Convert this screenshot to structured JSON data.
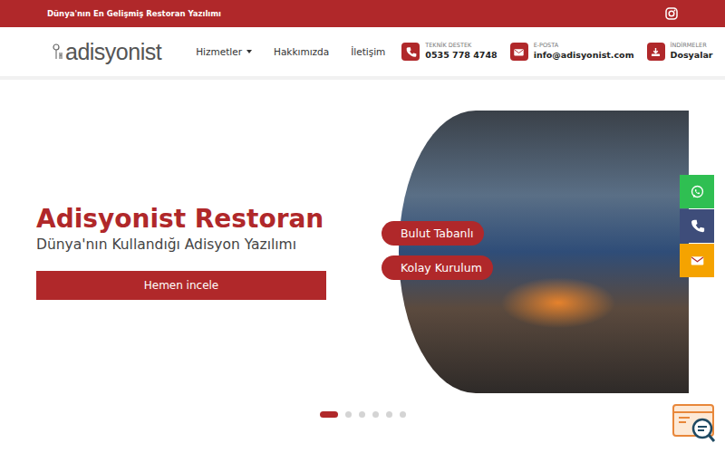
{
  "top_bar": {
    "text": "Dünya'nın En Gelişmiş Restoran Yazılımı"
  },
  "nav": {
    "logo": "adisyonist",
    "items": [
      {
        "label": "Hizmetler",
        "has_dropdown": true
      },
      {
        "label": "Hakkımızda",
        "has_dropdown": false
      },
      {
        "label": "İletişim",
        "has_dropdown": false
      }
    ],
    "contacts": [
      {
        "kind": "phone",
        "label": "TEKNİK DESTEK",
        "value": "0535 778 4748"
      },
      {
        "kind": "email",
        "label": "E-POSTA",
        "value": "info@adisyonist.com"
      },
      {
        "kind": "download",
        "label": "İNDİRMELER",
        "value": "Dosyalar"
      }
    ]
  },
  "hero": {
    "title": "Adisyonist Restoran",
    "subtitle": "Dünya'nın Kullandığı Adisyon Yazılımı",
    "button": "Hemen incele",
    "badges": [
      "Bulut Tabanlı",
      "Kolay Kurulum"
    ]
  },
  "carousel": {
    "dots": [
      {
        "selected": true
      },
      {
        "selected": false
      },
      {
        "selected": false
      },
      {
        "selected": false
      },
      {
        "selected": false
      },
      {
        "selected": false
      }
    ]
  },
  "side_buttons": [
    {
      "kind": "whatsapp",
      "color": "#2fbf52"
    },
    {
      "kind": "phone",
      "color": "#3e4d7a"
    },
    {
      "kind": "email",
      "color": "#f5a300"
    }
  ]
}
